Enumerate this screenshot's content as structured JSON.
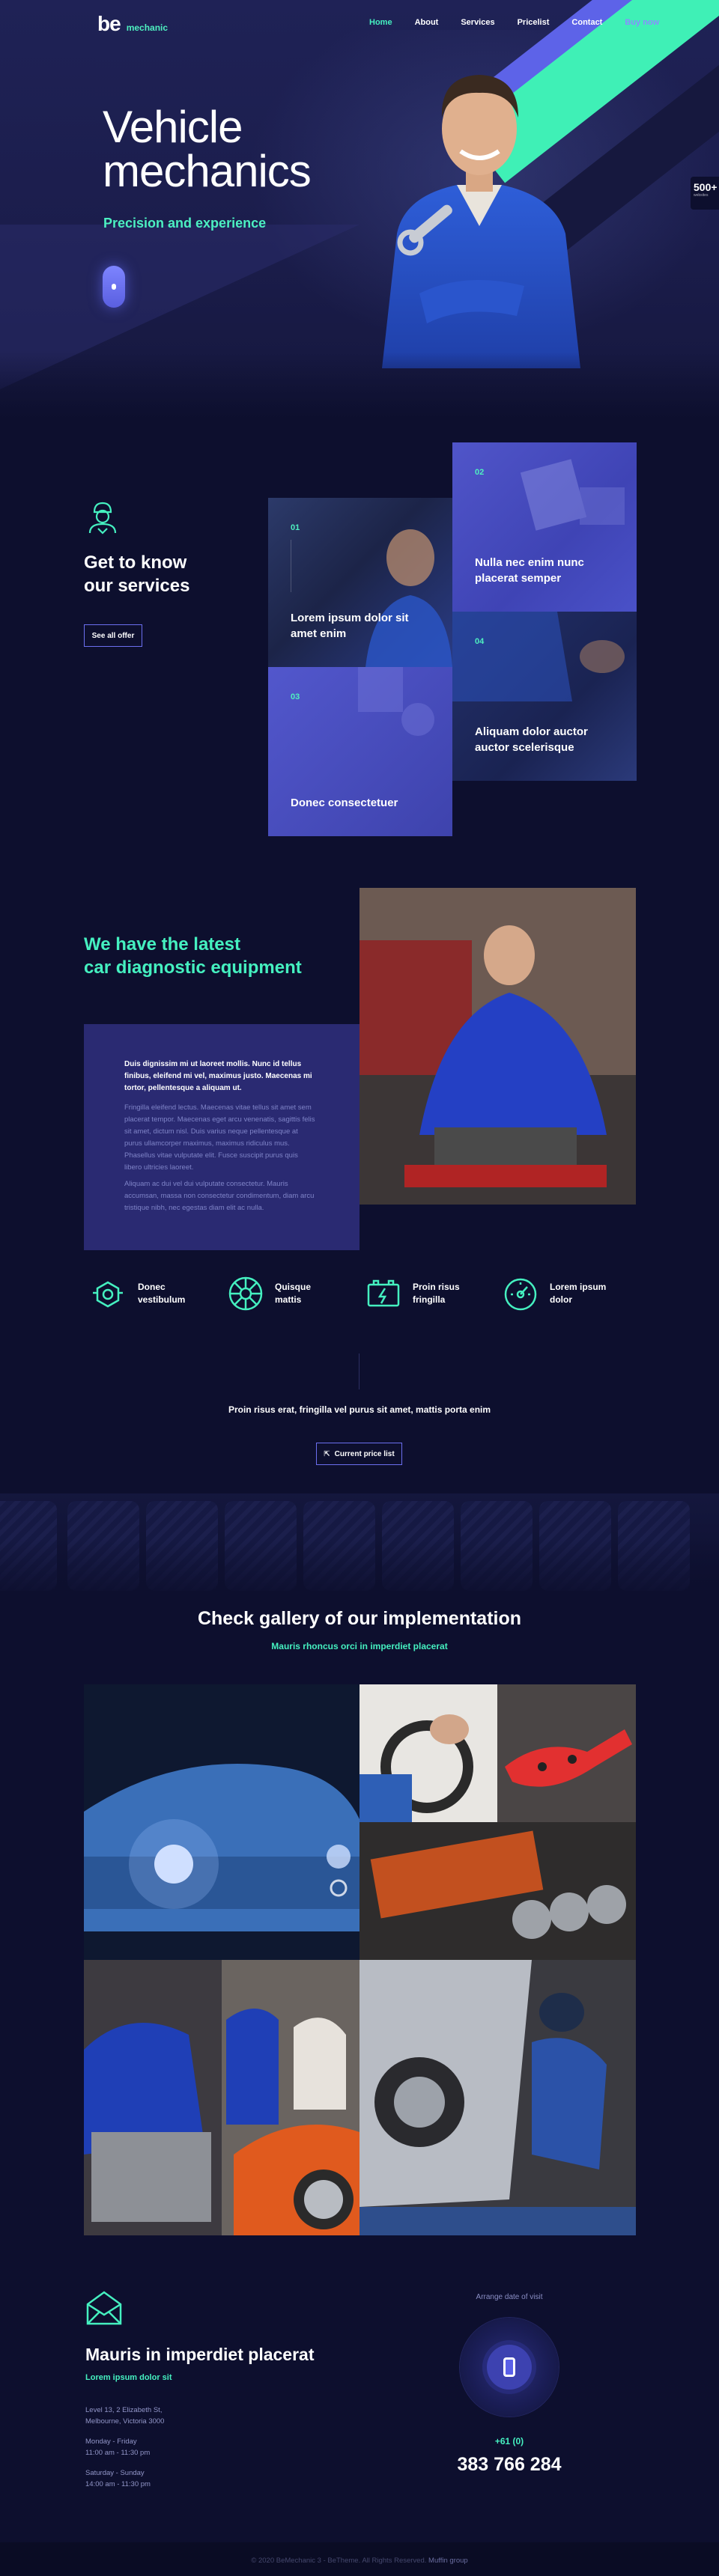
{
  "brand": {
    "logo_main": "be",
    "logo_sub": "mechanic"
  },
  "nav": {
    "items": [
      {
        "label": "Home",
        "active": true
      },
      {
        "label": "About"
      },
      {
        "label": "Services"
      },
      {
        "label": "Pricelist"
      },
      {
        "label": "Contact"
      },
      {
        "label": "Buy now",
        "highlight": true
      }
    ]
  },
  "hero": {
    "title_line1": "Vehicle",
    "title_line2": "mechanics",
    "subtitle": "Precision and experience",
    "badge_number": "500+",
    "badge_text": "websites"
  },
  "services": {
    "title_line1": "Get to know",
    "title_line2": "our services",
    "button": "See all offer",
    "tiles": [
      {
        "num": "01",
        "title": "Lorem ipsum dolor sit amet enim"
      },
      {
        "num": "02",
        "title": "Nulla nec enim nunc placerat semper"
      },
      {
        "num": "03",
        "title": "Donec consectetuer"
      },
      {
        "num": "04",
        "title": "Aliquam dolor auctor auctor scelerisque"
      }
    ]
  },
  "diagnostic": {
    "title_line1": "We have the latest",
    "title_line2": "car diagnostic equipment",
    "lead": "Duis dignissim mi ut laoreet mollis. Nunc id tellus finibus, eleifend mi vel, maximus justo. Maecenas mi tortor, pellentesque a aliquam ut.",
    "para1": "Fringilla eleifend lectus. Maecenas vitae tellus sit amet sem placerat tempor. Maecenas eget arcu venenatis, sagittis felis sit amet, dictum nisl. Duis varius neque pellentesque at purus ullamcorper maximus, maximus ridiculus mus. Phasellus vitae vulputate elit. Fusce suscipit purus quis libero ultricies laoreet.",
    "para2": "Aliquam ac dui vel dui vulputate consectetur. Mauris accumsan, massa non consectetur condimentum, diam arcu tristique nibh, nec egestas diam elit ac nulla."
  },
  "features": [
    {
      "icon": "engine-icon",
      "label": "Donec vestibulum"
    },
    {
      "icon": "wheel-icon",
      "label": "Quisque mattis"
    },
    {
      "icon": "battery-icon",
      "label": "Proin risus fringilla"
    },
    {
      "icon": "gauge-icon",
      "label": "Lorem ipsum dolor"
    }
  ],
  "cta": {
    "text": "Proin risus erat, fringilla vel purus sit amet, mattis porta enim",
    "button": "Current price list"
  },
  "gallery": {
    "title": "Check gallery of our implementation",
    "subtitle": "Mauris rhoncus orci in imperdiet placerat"
  },
  "contact": {
    "title": "Mauris in imperdiet placerat",
    "subtitle": "Lorem ipsum dolor sit",
    "address_line1": "Level 13, 2 Elizabeth St,",
    "address_line2": "Melbourne, Victoria 3000",
    "hours1_days": "Monday - Friday",
    "hours1_time": "11:00 am - 11:30 pm",
    "hours2_days": "Saturday - Sunday",
    "hours2_time": "14:00 am - 11:30 pm",
    "visit_label": "Arrange date of visit",
    "phone_code": "+61 (0)",
    "phone_number": "383 766 284"
  },
  "footer": {
    "text": "© 2020 BeMechanic 3 - BeTheme. All Rights Reserved.",
    "brand": "Muffin group"
  },
  "colors": {
    "accent_green": "#45f0c0",
    "accent_purple": "#5d63e8",
    "bg": "#0d0f2e"
  }
}
